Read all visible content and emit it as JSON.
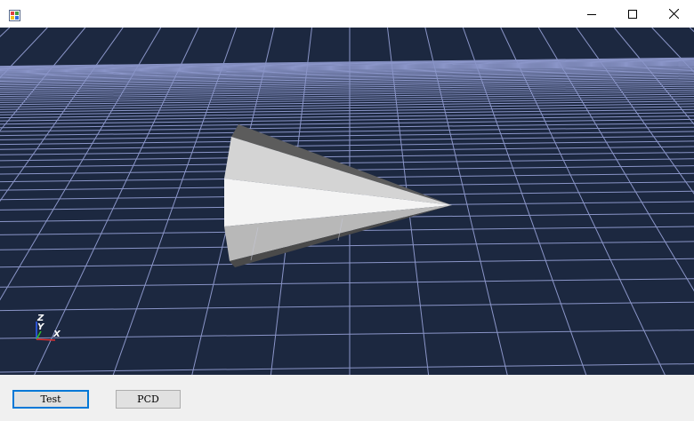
{
  "window": {
    "title": "",
    "icon": "winforms-app-icon",
    "caption_buttons": [
      "minimize-icon",
      "maximize-icon",
      "close-icon"
    ]
  },
  "viewport": {
    "background": "#1c2840",
    "grid_color": "#9ea8e0",
    "axes": {
      "x_label": "X",
      "y_label": "Y",
      "z_label": "Z",
      "x_color": "#e03030",
      "y_color": "#30c030",
      "z_color": "#3060ff"
    },
    "object": "cone"
  },
  "buttons": {
    "test_label": "Test",
    "pcd_label": "PCD"
  }
}
